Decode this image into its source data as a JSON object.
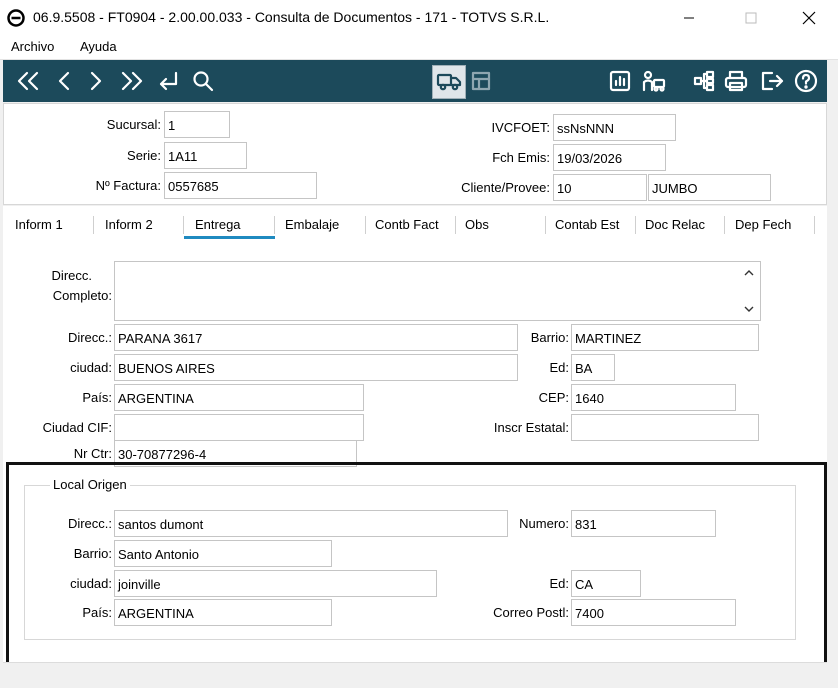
{
  "window": {
    "title": "06.9.5508 - FT0904 - 2.00.00.033 - Consulta de Documentos - 171 - TOTVS S.R.L."
  },
  "menu": {
    "items": [
      "Archivo",
      "Ayuda"
    ]
  },
  "header": {
    "sucursal": {
      "label": "Sucursal:",
      "value": "1"
    },
    "serie": {
      "label": "Serie:",
      "value": "1A11"
    },
    "factura": {
      "label": "Nº Factura:",
      "value": "0557685"
    },
    "ivcfoet": {
      "label": "IVCFOET:",
      "value": "ssNsNNN"
    },
    "fch_emis": {
      "label": "Fch Emis:",
      "value": "19/03/2026"
    },
    "cliente": {
      "label": "Cliente/Provee:",
      "code": "10",
      "name": "JUMBO"
    }
  },
  "tabs": [
    "Inform 1",
    "Inform 2",
    "Entrega",
    "Embalaje",
    "Contb Fact",
    "Obs",
    "Contab Est",
    "Doc Relac",
    "Dep Fech"
  ],
  "entrega": {
    "direcc_completo_label_1": "Direcc.",
    "direcc_completo_label_2": "Completo:",
    "direcc_completo_value": "",
    "direcc": {
      "label": "Direcc.:",
      "value": "PARANA  3617"
    },
    "barrio": {
      "label": "Barrio:",
      "value": "MARTINEZ"
    },
    "ciudad": {
      "label": "ciudad:",
      "value": "BUENOS AIRES"
    },
    "ed": {
      "label": "Ed:",
      "value": "BA"
    },
    "pais": {
      "label": "País:",
      "value": "ARGENTINA"
    },
    "cep": {
      "label": "CEP:",
      "value": "1640"
    },
    "ciudad_cif": {
      "label": "Ciudad CIF:",
      "value": ""
    },
    "inscr_estatal": {
      "label": "Inscr Estatal:",
      "value": ""
    },
    "nr_ctr": {
      "label": "Nr Ctr:",
      "value": "30-70877296-4"
    }
  },
  "local_origen": {
    "title": "Local Origen",
    "direcc": {
      "label": "Direcc.:",
      "value": "santos dumont"
    },
    "numero": {
      "label": "Numero:",
      "value": "831"
    },
    "barrio": {
      "label": "Barrio:",
      "value": "Santo Antonio"
    },
    "ciudad": {
      "label": "ciudad:",
      "value": "joinville"
    },
    "ed": {
      "label": "Ed:",
      "value": "CA"
    },
    "pais": {
      "label": "País:",
      "value": "ARGENTINA"
    },
    "correo_postal": {
      "label": "Correo Postl:",
      "value": "7400"
    }
  },
  "colors": {
    "toolbar": "#1c4a5b",
    "tab_accent": "#1f8ac0"
  }
}
